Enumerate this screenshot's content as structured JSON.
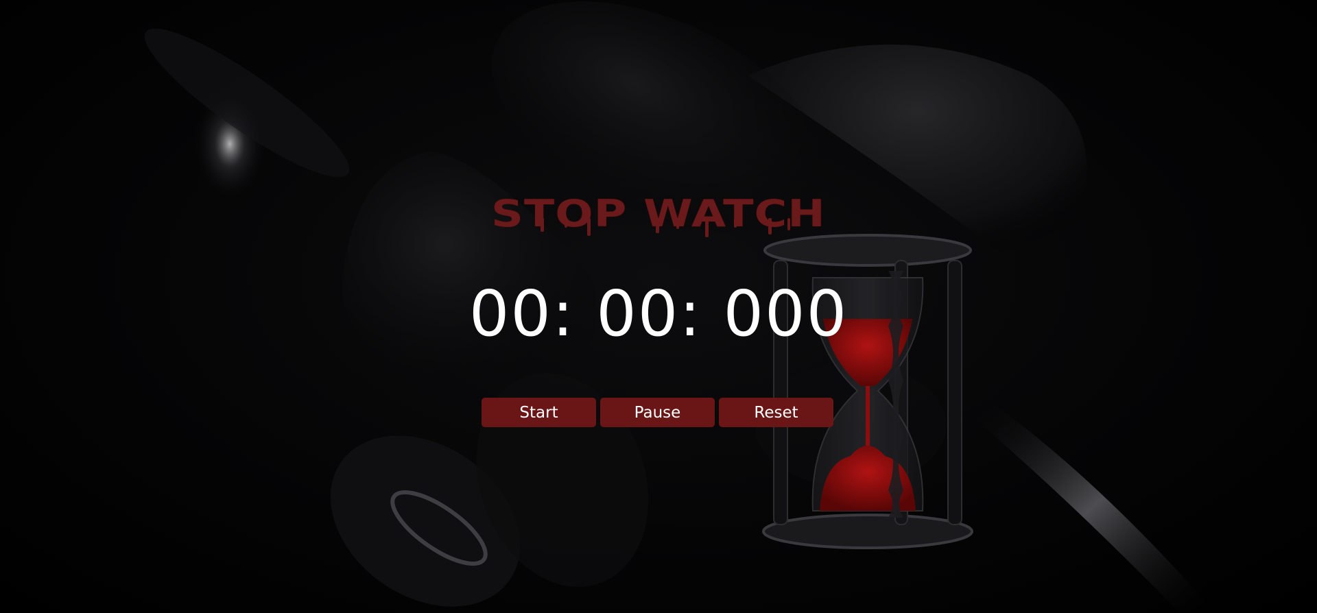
{
  "app": {
    "title": "STOP WATCH"
  },
  "timer": {
    "display": "00: 00: 000"
  },
  "controls": {
    "start_label": "Start",
    "pause_label": "Pause",
    "reset_label": "Reset"
  },
  "colors": {
    "accent": "#6b1616",
    "title": "#6a1a1a",
    "background": "#000000",
    "text": "#ffffff",
    "sand": "#8b0d0d"
  },
  "icons": {
    "hourglass": "hourglass-icon"
  }
}
